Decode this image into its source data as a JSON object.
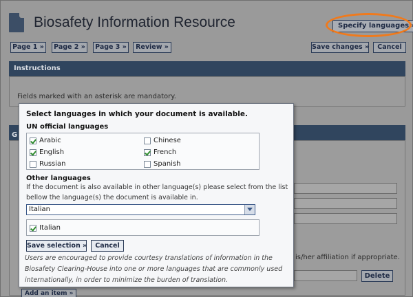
{
  "header": {
    "title": "Biosafety Information Resource",
    "specify_languages": "Specify languages »"
  },
  "nav": {
    "page1": "Page 1 »",
    "page2": "Page 2 »",
    "page3": "Page 3 »",
    "review": "Review »",
    "save_changes": "Save changes »",
    "cancel": "Cancel"
  },
  "instructions": {
    "heading": "Instructions",
    "text": "Fields marked with an asterisk are mandatory."
  },
  "background": {
    "section_letter": "G",
    "affiliation_fragment": "is/her affiliation if appropriate.",
    "delete": "Delete",
    "add_item": "Add an item »"
  },
  "dialog": {
    "heading": "Select languages in which your document is available.",
    "un_heading": "UN official languages",
    "un_languages": [
      {
        "label": "Arabic",
        "checked": true
      },
      {
        "label": "Chinese",
        "checked": false
      },
      {
        "label": "English",
        "checked": true
      },
      {
        "label": "French",
        "checked": true
      },
      {
        "label": "Russian",
        "checked": false
      },
      {
        "label": "Spanish",
        "checked": false
      }
    ],
    "other_heading": "Other languages",
    "other_note_line1": "If the document is also available in other language(s) please select from the list",
    "other_note_line2": "bellow the language(s) the document is available in.",
    "select_value": "Italian",
    "selected_languages": [
      {
        "label": "Italian",
        "checked": true
      }
    ],
    "save_selection": "Save selection »",
    "cancel": "Cancel",
    "footer_line1": "Users are encouraged to provide courtesy translations of information in the",
    "footer_line2": "Biosafety Clearing-House into one or more languages that are commonly used",
    "footer_line3": "internationally, in order to minimize the burden of translation."
  },
  "colors": {
    "highlight_ring": "#f07a1c",
    "section_header": "#30455e",
    "button_border": "#2b3b57"
  }
}
